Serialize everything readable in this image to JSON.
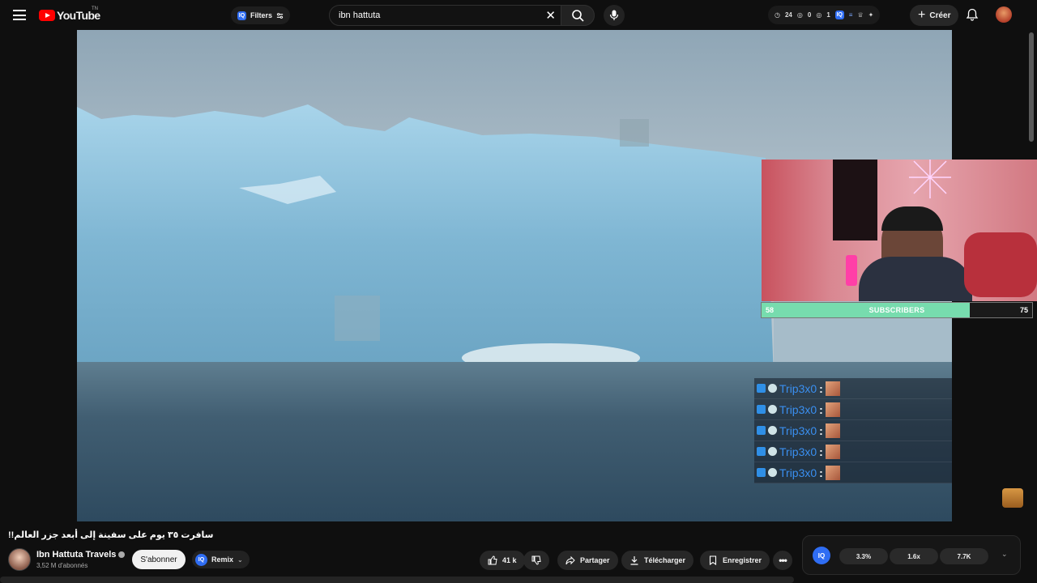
{
  "header": {
    "logo_text": "YouTube",
    "logo_suffix": "TN",
    "filters_label": "Filters",
    "search_value": "ibn hattuta",
    "stats": {
      "views": "24",
      "eye": "0",
      "circle": "1"
    },
    "create_label": "Créer"
  },
  "overlay": {
    "sub_current": "58",
    "sub_label": "SUBSCRIBERS",
    "sub_goal": "75",
    "sub_progress": 0.77,
    "chat": [
      {
        "name": "Trip3x0",
        "sep": ":"
      },
      {
        "name": "Trip3x0",
        "sep": ":"
      },
      {
        "name": "Trip3x0",
        "sep": ":"
      },
      {
        "name": "Trip3x0",
        "sep": ":"
      },
      {
        "name": "Trip3x0",
        "sep": ":"
      }
    ]
  },
  "video": {
    "title": "!!سافرت ٣٥ يوم على سفينة إلى أبعد جزر العالم",
    "channel_name": "Ibn Hattuta Travels",
    "subscribers": "3,52 M d'abonnés",
    "subscribe_label": "S'abonner",
    "remix_label": "Remix",
    "likes": "41 k",
    "share_label": "Partager",
    "download_label": "Télécharger",
    "save_label": "Enregistrer"
  },
  "iq_panel": {
    "badge": "IQ",
    "stat1": "3.3%",
    "stat2": "1.6x",
    "stat3": "7.7K"
  },
  "colors": {
    "brand_red": "#ff0000",
    "iq_blue": "#2f6df3",
    "sub_bar_green": "#77dcae",
    "chat_name_blue": "#3a8ff0"
  }
}
